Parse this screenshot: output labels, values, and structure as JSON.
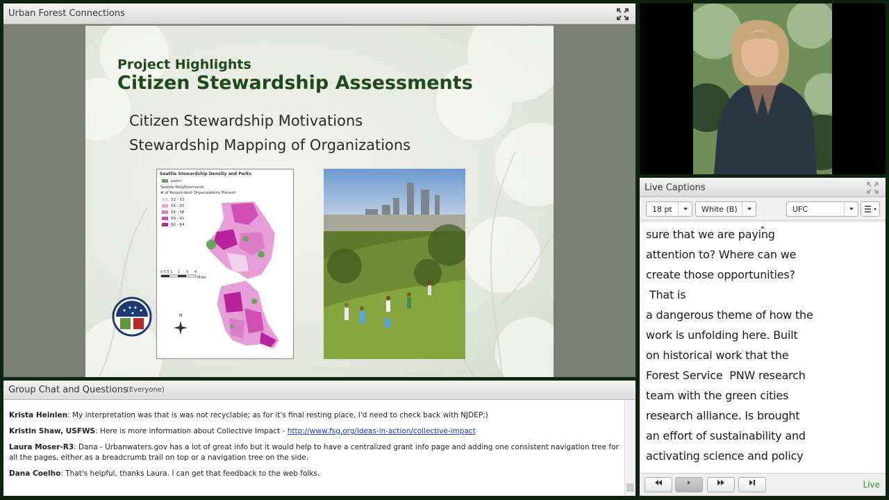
{
  "share_pod": {
    "title": "Urban Forest Connections",
    "slide": {
      "kicker": "Project Highlights",
      "title": "Citizen Stewardship Assessments",
      "bullets": [
        "Citizen Stewardship Motivations",
        "Stewardship Mapping of Organizations"
      ],
      "map": {
        "title": "Seattle Stewardship Density and Parks",
        "legend_parks": "parks",
        "legend_neighborhoods": "Seattle Neighborhoods",
        "legend_header": "# of Respondent Organizations Present",
        "legend_ranges": [
          "52 - 53",
          "54 - 55",
          "56 - 58",
          "59 - 61",
          "62 - 64"
        ],
        "legend_colors": [
          "#f3d2ec",
          "#e8a9da",
          "#dd7cc8",
          "#cf4fb5",
          "#b8229c"
        ],
        "scale_labels": [
          "0 0.5 1",
          "2",
          "3",
          "4"
        ],
        "scale_unit": "Miles",
        "north_label": "N"
      }
    }
  },
  "captions": {
    "title": "Live Captions",
    "font_size": "18 pt",
    "color": "White (B)",
    "channel": "UFC",
    "lines": [
      "sure that we are paying",
      "attention to? Where can we",
      "create those opportunities?",
      " That is",
      "a dangerous theme of how the",
      "work is unfolding here. Built",
      "on historical work that the",
      "Forest Service  PNW research",
      "team with the green cities",
      "research alliance. Is brought",
      "an effort of sustainability and",
      "activating science and policy"
    ],
    "controls": [
      "rewind",
      "play",
      "fast-forward",
      "skip-to-end"
    ],
    "live_label": "Live"
  },
  "chat": {
    "title": "Group Chat and Questions",
    "scope": "(Everyone)",
    "messages": [
      {
        "author": "Krista Heinlen",
        "text": " My interpretation was that is was not recyclable; as for it's final resting place, I'd need to check back with NJDEP;)"
      },
      {
        "author": "Kristin Shaw, USFWS",
        "text": " Here is more information about Collective Impact - ",
        "link": "http://www.fsg.org/ideas-in-action/collective-impact"
      },
      {
        "author": "Laura Moser-R3",
        "text": " Dana - Urbanwaters.gov has a lot of great info but it would help to have a centralized grant info page and adding one consistent navigation tree for all the pages, either as a breadcrumb trail on top or a navigation tree on the side."
      },
      {
        "author": "Dana Coelho",
        "text": " That's helpful, thanks Laura. I can get that feedback to the web folks."
      }
    ]
  }
}
